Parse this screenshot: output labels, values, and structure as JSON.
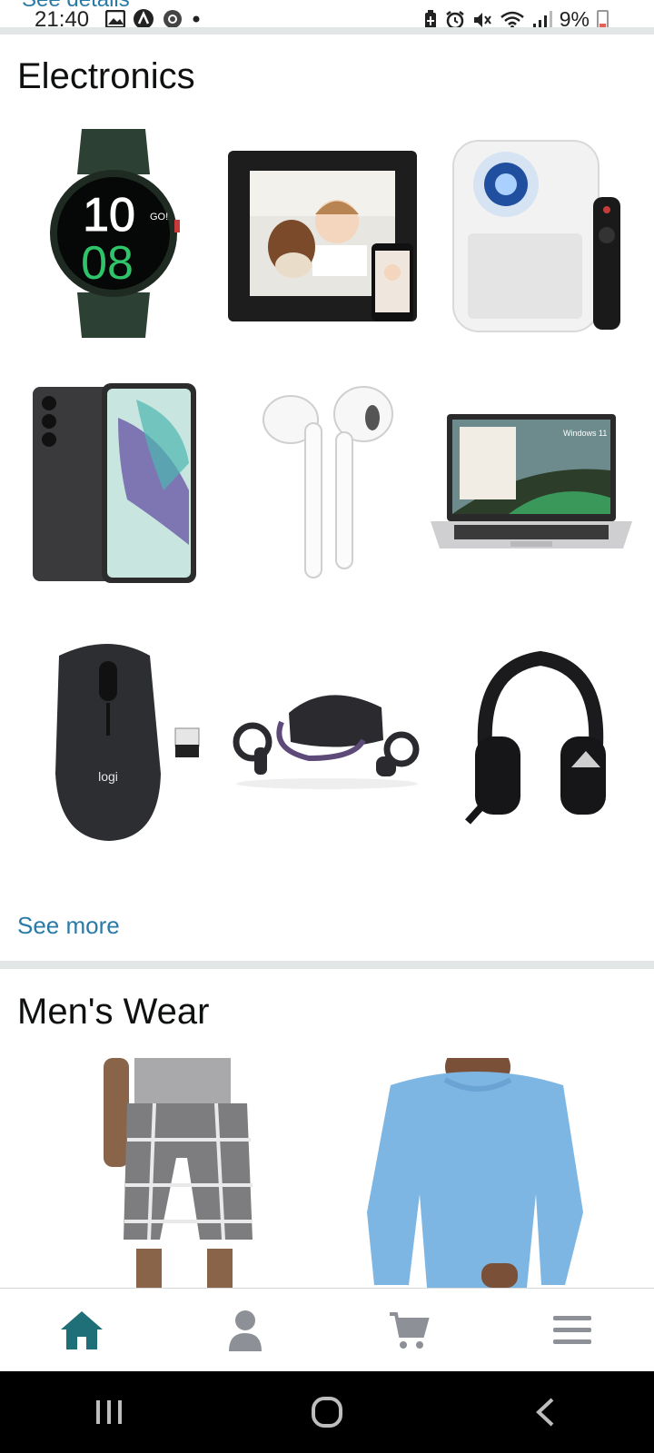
{
  "status_bar": {
    "peek_text": "See details",
    "time": "21:40",
    "battery": "9%",
    "left_icons": [
      "gallery-icon",
      "a-icon",
      "settings-icon",
      "dot-icon"
    ],
    "right_icons": [
      "battery-saver-icon",
      "alarm-icon",
      "mute-icon",
      "wifi-icon",
      "signal-icon"
    ]
  },
  "electronics": {
    "title": "Electronics",
    "products": [
      {
        "name": "smartwatch",
        "watch_time_top": "10",
        "watch_time_bottom": "08",
        "watch_label": "GO!"
      },
      {
        "name": "digital-photo-frame"
      },
      {
        "name": "mini-projector"
      },
      {
        "name": "smartphone"
      },
      {
        "name": "wireless-earbuds"
      },
      {
        "name": "laptop",
        "screen_label": "Windows 11"
      },
      {
        "name": "wireless-mouse",
        "brand": "logi"
      },
      {
        "name": "vr-headset"
      },
      {
        "name": "gaming-headset"
      }
    ],
    "see_more": "See more"
  },
  "mens_wear": {
    "title": "Men's Wear",
    "products": [
      {
        "name": "plaid-cargo-shorts"
      },
      {
        "name": "blue-long-sleeve-shirt"
      }
    ]
  },
  "bottom_nav": {
    "items": [
      {
        "icon": "home-icon",
        "active": true
      },
      {
        "icon": "account-icon",
        "active": false
      },
      {
        "icon": "cart-icon",
        "active": false
      },
      {
        "icon": "menu-icon",
        "active": false
      }
    ],
    "active_color": "#1f6f78",
    "inactive_color": "#8d9096"
  },
  "colors": {
    "link": "#2a7aa8",
    "divider": "#e3e6e6"
  }
}
